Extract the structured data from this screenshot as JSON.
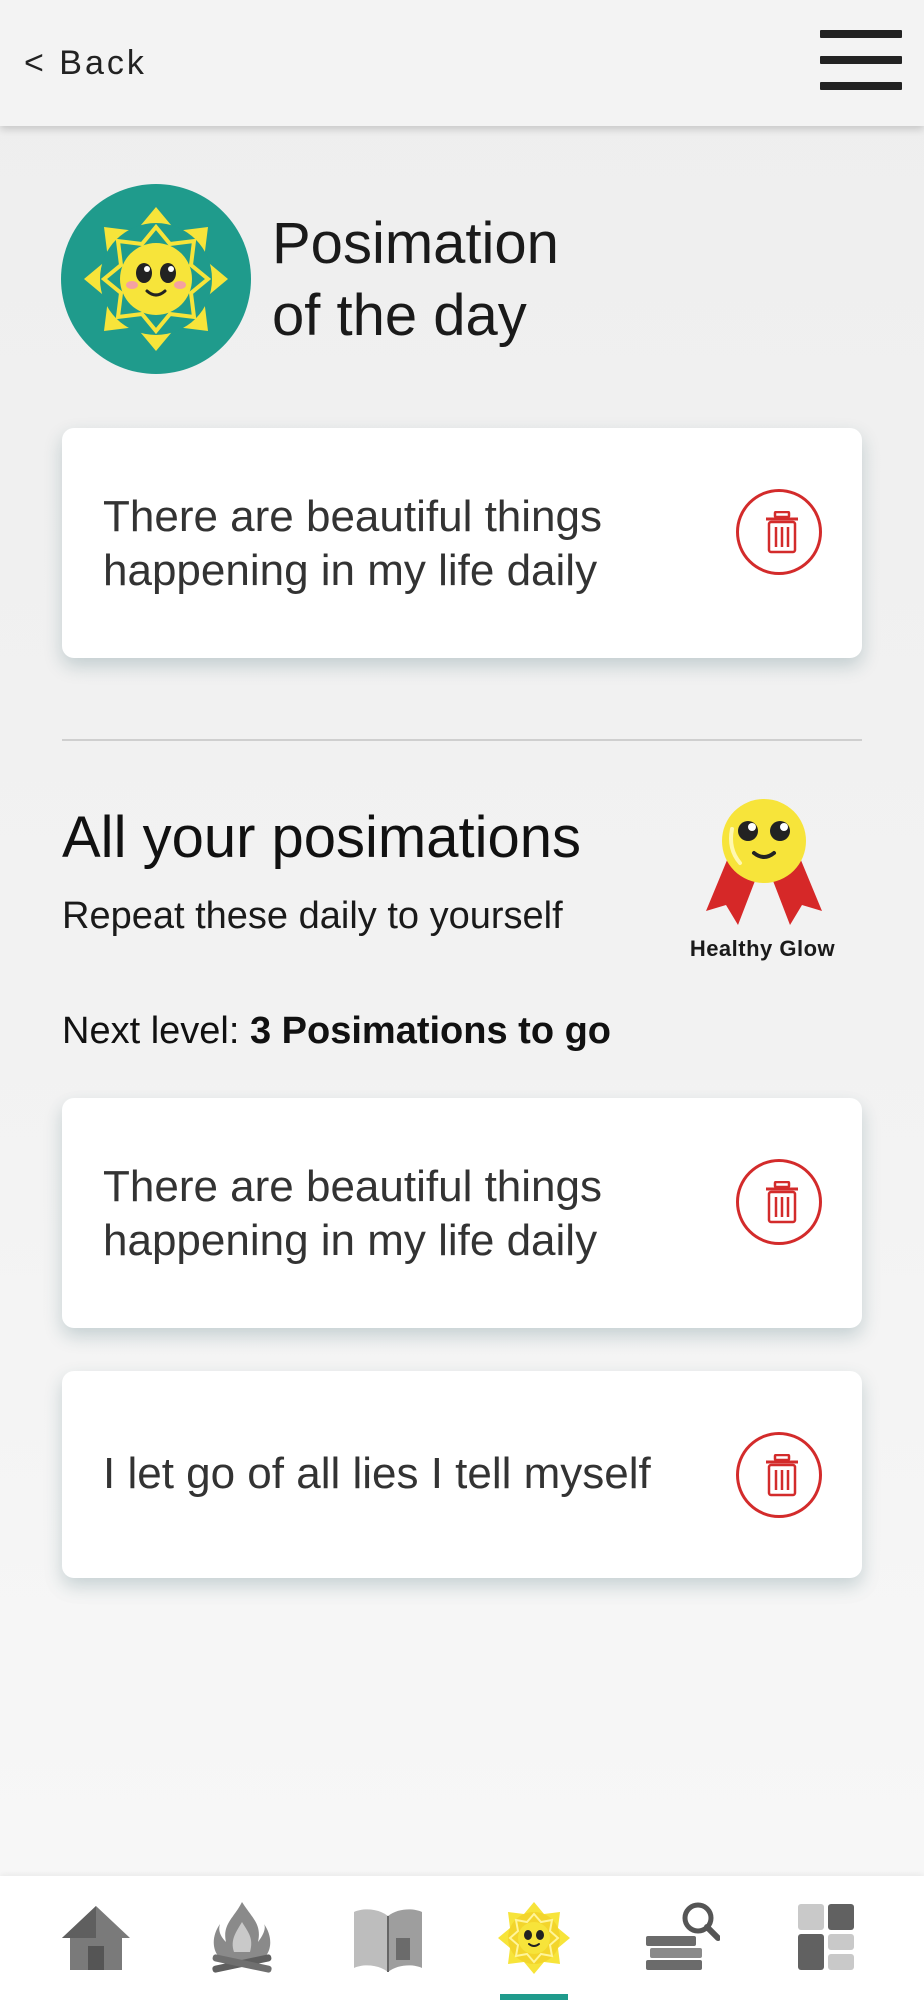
{
  "header": {
    "back_label": "< Back"
  },
  "hero": {
    "title_line1": "Posimation",
    "title_line2": "of the day"
  },
  "daily_card": {
    "text": "There are beautiful things happening in my life daily"
  },
  "all_section": {
    "title": "All your posimations",
    "subtitle": "Repeat these daily to yourself",
    "badge_label": "Healthy Glow",
    "next_level_prefix": "Next level: ",
    "next_level_value": "3 Posimations to go"
  },
  "posimations": [
    {
      "text": "There are beautiful things happening in my life daily"
    },
    {
      "text": "I let go of all lies I tell myself"
    }
  ],
  "bottom_nav": {
    "items": [
      {
        "icon": "home-icon"
      },
      {
        "icon": "campfire-icon"
      },
      {
        "icon": "book-icon"
      },
      {
        "icon": "posimation-sun-icon",
        "active": true
      },
      {
        "icon": "research-books-icon"
      },
      {
        "icon": "dashboard-icon"
      }
    ]
  },
  "colors": {
    "accent": "#1f9b8c",
    "danger": "#d32b2b",
    "sun_yellow": "#f7e43a"
  }
}
